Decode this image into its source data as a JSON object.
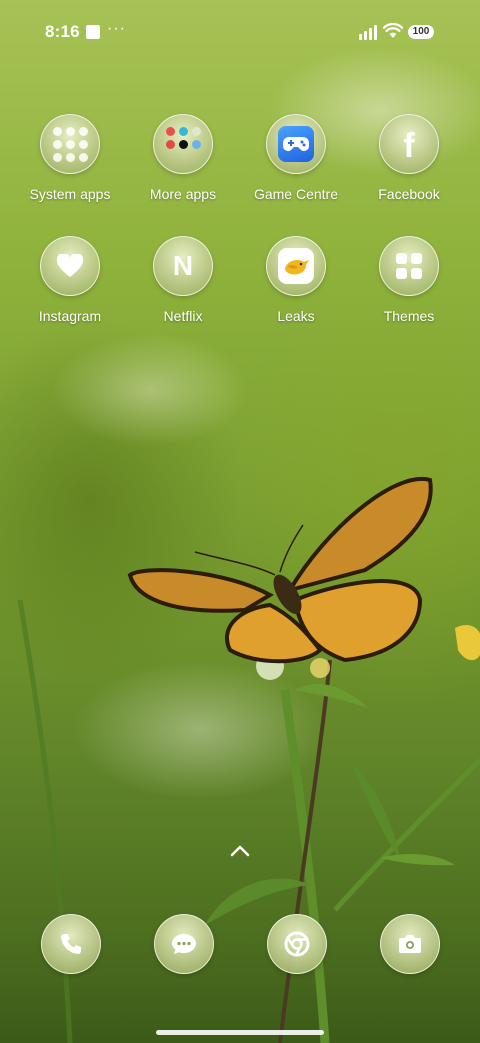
{
  "status_bar": {
    "time": "8:16",
    "overflow_indicator": "···",
    "battery_level": "100"
  },
  "apps": [
    {
      "label": "System apps",
      "icon": "system-apps-folder-icon"
    },
    {
      "label": "More apps",
      "icon": "more-apps-folder-icon"
    },
    {
      "label": "Game Centre",
      "icon": "gamepad-icon"
    },
    {
      "label": "Facebook",
      "icon": "facebook-icon"
    },
    {
      "label": "Instagram",
      "icon": "heart-icon"
    },
    {
      "label": "Netflix",
      "icon": "netflix-icon"
    },
    {
      "label": "Leaks",
      "icon": "bird-icon"
    },
    {
      "label": "Themes",
      "icon": "themes-grid-icon"
    }
  ],
  "dock": [
    {
      "name": "phone",
      "icon": "phone-icon"
    },
    {
      "name": "messages",
      "icon": "message-icon"
    },
    {
      "name": "browser",
      "icon": "chrome-icon"
    },
    {
      "name": "camera",
      "icon": "camera-icon"
    }
  ],
  "colors": {
    "wallpaper_top": "#a7c255",
    "wallpaper_bottom": "#3c5a18",
    "game_centre_blue": "#1f62e0",
    "leaks_yellow": "#f2b51e"
  }
}
